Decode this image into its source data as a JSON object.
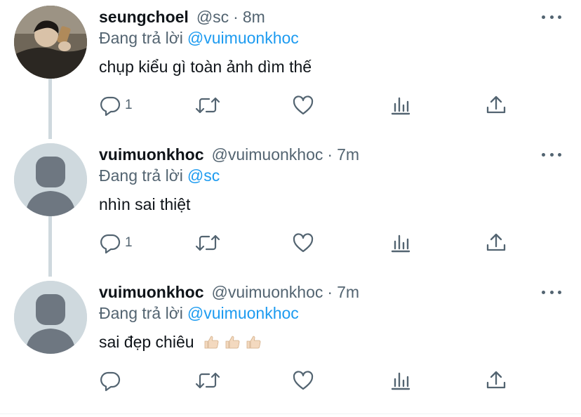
{
  "tweets": [
    {
      "name": "seungchoel",
      "handle": "@sc",
      "separator": "·",
      "time": "8m",
      "reply_prefix": "Đang trả lời",
      "reply_to": "@vuimuonkhoc",
      "text": "chụp kiểu gì toàn ảnh dìm thế",
      "reply_count": "1",
      "emoji_count": 0
    },
    {
      "name": "vuimuonkhoc",
      "handle": "@vuimuonkhoc",
      "separator": "·",
      "time": "7m",
      "reply_prefix": "Đang trả lời",
      "reply_to": "@sc",
      "text": "nhìn sai thiệt",
      "reply_count": "1",
      "emoji_count": 0
    },
    {
      "name": "vuimuonkhoc",
      "handle": "@vuimuonkhoc",
      "separator": "·",
      "time": "7m",
      "reply_prefix": "Đang trả lời",
      "reply_to": "@vuimuonkhoc",
      "text": "sai đẹp chiêu",
      "reply_count": "",
      "emoji_count": 3,
      "emoji_name": "thumbs-up"
    }
  ],
  "icons": {
    "reply": "reply-icon",
    "retweet": "retweet-icon",
    "like": "heart-icon",
    "analytics": "analytics-icon",
    "share": "share-icon",
    "more": "more-icon"
  },
  "colors": {
    "text": "#0f1419",
    "secondary": "#536471",
    "link": "#1d9bf0",
    "thread_line": "#cfd9de",
    "avatar_placeholder": "#cfd9de",
    "avatar_figure": "#6e7781"
  }
}
